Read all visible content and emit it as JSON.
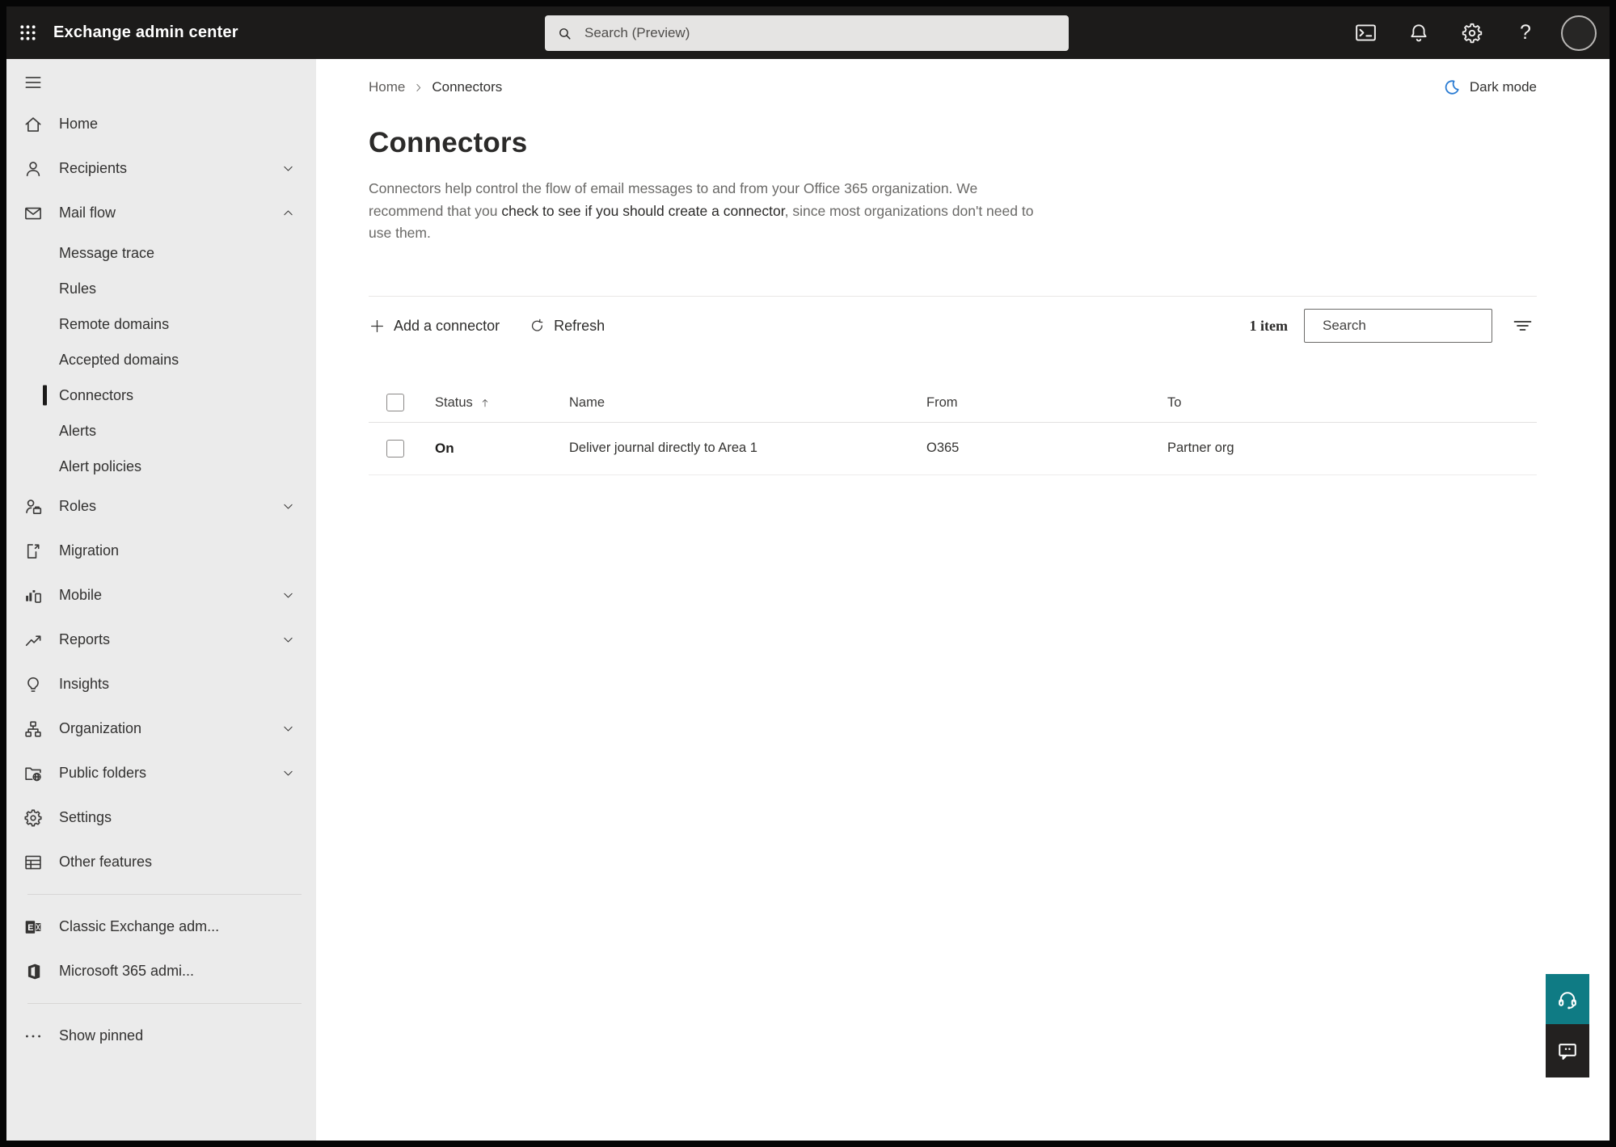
{
  "topbar": {
    "app_title": "Exchange admin center",
    "search_placeholder": "Search (Preview)",
    "help_glyph": "?"
  },
  "sidebar": {
    "items": [
      {
        "label": "Home"
      },
      {
        "label": "Recipients"
      },
      {
        "label": "Mail flow"
      },
      {
        "label": "Message trace"
      },
      {
        "label": "Rules"
      },
      {
        "label": "Remote domains"
      },
      {
        "label": "Accepted domains"
      },
      {
        "label": "Connectors"
      },
      {
        "label": "Alerts"
      },
      {
        "label": "Alert policies"
      },
      {
        "label": "Roles"
      },
      {
        "label": "Migration"
      },
      {
        "label": "Mobile"
      },
      {
        "label": "Reports"
      },
      {
        "label": "Insights"
      },
      {
        "label": "Organization"
      },
      {
        "label": "Public folders"
      },
      {
        "label": "Settings"
      },
      {
        "label": "Other features"
      }
    ],
    "footer": {
      "classic_exchange": "Classic Exchange adm...",
      "microsoft_365": "Microsoft 365 admi...",
      "show_pinned": "Show pinned"
    }
  },
  "page": {
    "breadcrumb": {
      "home": "Home",
      "current": "Connectors"
    },
    "dark_mode_label": "Dark mode",
    "title": "Connectors",
    "description": {
      "part1": "Connectors help control the flow of email messages to and from your Office 365 organization. We recommend that you ",
      "emphasis": "check to see if you should create a connector",
      "part2": ", since most organizations don't need to use them."
    },
    "toolbar": {
      "add_label": "Add a connector",
      "refresh_label": "Refresh",
      "count": "1 item",
      "search_placeholder": "Search"
    },
    "table": {
      "headers": {
        "status": "Status",
        "name": "Name",
        "from": "From",
        "to": "To"
      },
      "rows": [
        {
          "status": "On",
          "name": "Deliver journal directly to Area 1",
          "from": "O365",
          "to": "Partner org"
        }
      ]
    }
  },
  "colors": {
    "topbar_bg": "#1c1b1a",
    "sidebar_bg": "#ebebeb",
    "moon_blue": "#2b7cd3",
    "help_teal": "#0f7b84",
    "feedback_dark": "#232120"
  }
}
